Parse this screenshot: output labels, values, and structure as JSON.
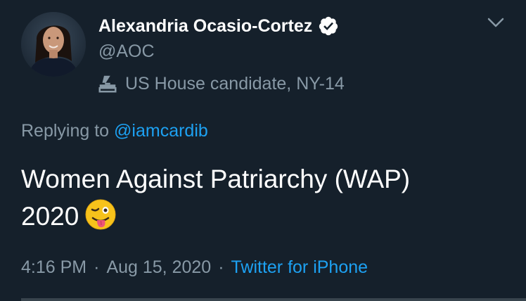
{
  "author": {
    "name": "Alexandria Ocasio-Cortez",
    "handle": "@AOC",
    "label": "US House candidate, NY-14",
    "verified": true
  },
  "reply": {
    "prefix": "Replying to",
    "mention": "@iamcardib"
  },
  "tweet": {
    "line1": "Women Against Patriarchy (WAP)",
    "line2": "2020"
  },
  "meta": {
    "time": "4:16 PM",
    "sep1": "·",
    "date": "Aug 15, 2020",
    "sep2": "·",
    "source": "Twitter for iPhone"
  },
  "icons": {
    "verified": "verified-badge-icon",
    "label": "ballot-box-icon",
    "menu": "chevron-down-icon",
    "emoji": "winking-face-with-tongue-emoji"
  },
  "colors": {
    "background": "#15202b",
    "secondary_text": "#8899a6",
    "link": "#1da1f2"
  }
}
